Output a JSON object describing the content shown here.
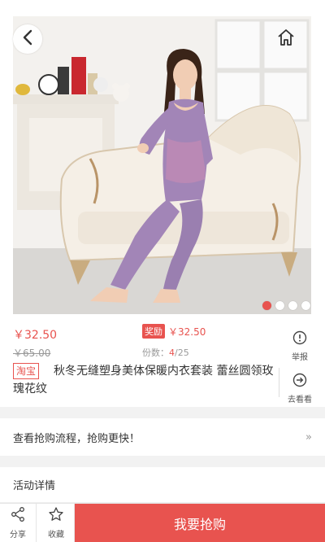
{
  "hero": {
    "dots": [
      true,
      false,
      false,
      false
    ]
  },
  "product": {
    "price": "￥32.50",
    "original_price": "￥65.00",
    "reward_badge": "奖励",
    "reward_price": "￥32.50",
    "stock_label": "份数：",
    "stock_remaining": "4",
    "stock_total": "/25",
    "platform_badge": "淘宝",
    "title": "秋冬无缝塑身美体保暖内衣套装 蕾丝圆领玫瑰花纹"
  },
  "side_actions": {
    "report_label": "举报",
    "view_label": "去看看"
  },
  "flow": {
    "text": "查看抢购流程，抢购更快！",
    "arrow": "»"
  },
  "activity": {
    "title": "活动详情"
  },
  "bottom_bar": {
    "share_label": "分享",
    "favorite_label": "收藏",
    "buy_label": "我要抢购"
  },
  "colors": {
    "accent": "#e8534f",
    "garment": "#9a7fb0"
  },
  "icons": [
    "back-icon",
    "home-icon",
    "alert-icon",
    "arrow-right-circle-icon",
    "share-icon",
    "star-icon"
  ]
}
